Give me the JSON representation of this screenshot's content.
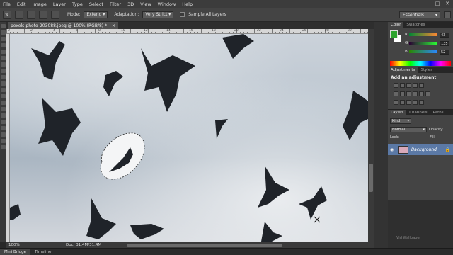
{
  "menu": [
    "File",
    "Edit",
    "Image",
    "Layer",
    "Type",
    "Select",
    "Filter",
    "3D",
    "View",
    "Window",
    "Help"
  ],
  "window_controls": [
    "–",
    "□",
    "✕"
  ],
  "options_bar": {
    "mode_label": "Mode:",
    "mode_value": "Extend",
    "adaptation_label": "Adaptation:",
    "adaptation_value": "Very Strict",
    "sample_all_layers": "Sample All Layers",
    "workspace": "Essentials"
  },
  "document_tab": {
    "title": "pexels-photo-203088.jpeg @ 100% (RGB/8) *",
    "close": "×"
  },
  "ruler_numbers": [
    "0",
    "2",
    "4",
    "6",
    "8",
    "10",
    "12",
    "14",
    "16",
    "18",
    "20",
    "22",
    "24",
    "26",
    "28",
    "30",
    "32"
  ],
  "status": {
    "zoom": "100%",
    "doc": "Doc: 31.4M/31.4M"
  },
  "mini_bar": {
    "mini_bridge": "Mini Bridge",
    "timeline": "Timeline"
  },
  "color_panel": {
    "tabs": [
      "Color",
      "Swatches"
    ],
    "channels": [
      {
        "ch": "R",
        "value": "43"
      },
      {
        "ch": "G",
        "value": "135"
      },
      {
        "ch": "B",
        "value": "52"
      }
    ],
    "foreground": "#2b8734"
  },
  "adjustments_panel": {
    "tabs": [
      "Adjustments",
      "Styles"
    ],
    "title": "Add an adjustment"
  },
  "layers_panel": {
    "tabs": [
      "Layers",
      "Channels",
      "Paths"
    ],
    "kind": "Kind",
    "blend_mode": "Normal",
    "opacity_label": "Opacity:",
    "lock_label": "Lock:",
    "fill_label": "Fill:",
    "layer_name": "Background"
  },
  "watermark": "Vid Wallpaper"
}
